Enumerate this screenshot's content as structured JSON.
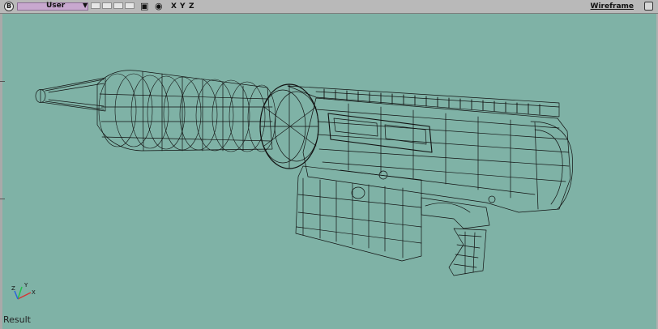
{
  "header": {
    "badge": "B",
    "view_name": "User",
    "axis_x": "X",
    "axis_y": "Y",
    "axis_z": "Z",
    "display_mode": "Wireframe"
  },
  "footer": {
    "label": "Result"
  },
  "colors": {
    "background": "#7fb2a6",
    "header": "#b9b9b9",
    "view_selector": "#c8a8cf",
    "wireframe": "#111111"
  },
  "icons": [
    "camera-icon",
    "eye-icon",
    "chevron-down-icon",
    "axis-gizmo-icon"
  ]
}
